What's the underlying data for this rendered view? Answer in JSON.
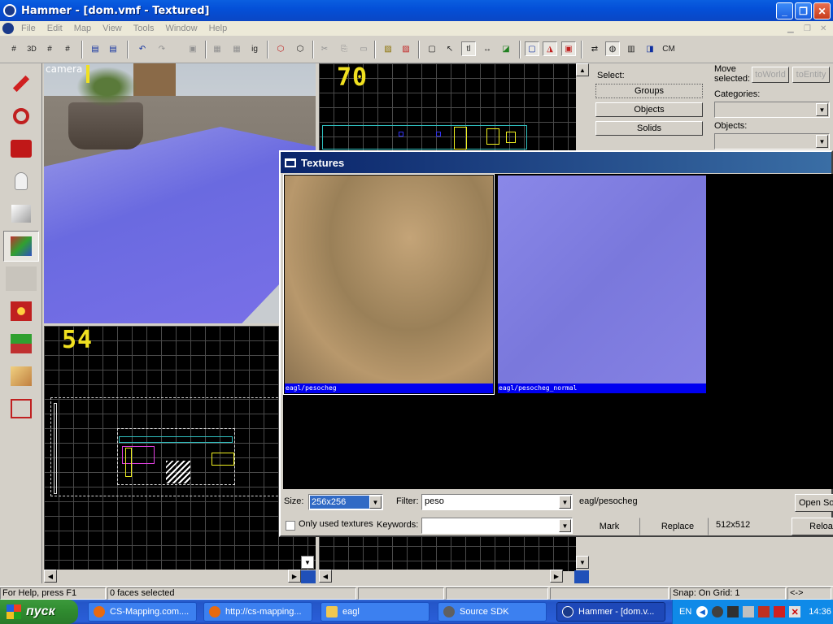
{
  "window": {
    "title": "Hammer - [dom.vmf - Textured]",
    "btn_min": "_",
    "btn_max": "❐",
    "btn_close": "✕"
  },
  "menu": [
    "File",
    "Edit",
    "Map",
    "View",
    "Tools",
    "Window",
    "Help"
  ],
  "toolbar": {
    "t1": "ig",
    "t2": "tl",
    "t3": "CM"
  },
  "viewports": {
    "camera_label": "camera",
    "top_right_number": "70",
    "bottom_left_number": "54"
  },
  "right_panel": {
    "select_label": "Select:",
    "groups": "Groups",
    "objects_btn": "Objects",
    "solids": "Solids",
    "move_selected": "Move\nselected:",
    "to_world": "toWorld",
    "to_entity": "toEntity",
    "categories_label": "Categories:",
    "objects_label": "Objects:"
  },
  "textures": {
    "title": "Textures",
    "items": [
      {
        "name": "eagl/pesocheg",
        "color": "#b09468"
      },
      {
        "name": "eagl/pesocheg_normal",
        "color": "#8080e0"
      }
    ],
    "size_label": "Size:",
    "size_value": "256x256",
    "filter_label": "Filter:",
    "filter_value": "peso",
    "selected_name": "eagl/pesocheg",
    "open_source": "Open Sour",
    "only_used": "Only used textures",
    "keywords_label": "Keywords:",
    "keywords_value": "",
    "mark": "Mark",
    "replace": "Replace",
    "dims": "512x512",
    "reload": "Reload"
  },
  "status": {
    "help": "For Help, press F1",
    "faces": "0 faces selected",
    "snap": "Snap: On Grid: 1",
    "arrows": "<->"
  },
  "taskbar": {
    "start": "пуск",
    "tasks": [
      {
        "label": "CS-Mapping.com....",
        "icon_color": "#e86a10"
      },
      {
        "label": "http://cs-mapping...",
        "icon_color": "#e86a10"
      },
      {
        "label": "eagl",
        "icon_color": "#f0c850"
      },
      {
        "label": "Source SDK",
        "icon_color": "#606060"
      },
      {
        "label": "Hammer - [dom.v...",
        "icon_color": "#1a3a8a"
      }
    ],
    "lang": "EN",
    "clock": "14:36"
  }
}
